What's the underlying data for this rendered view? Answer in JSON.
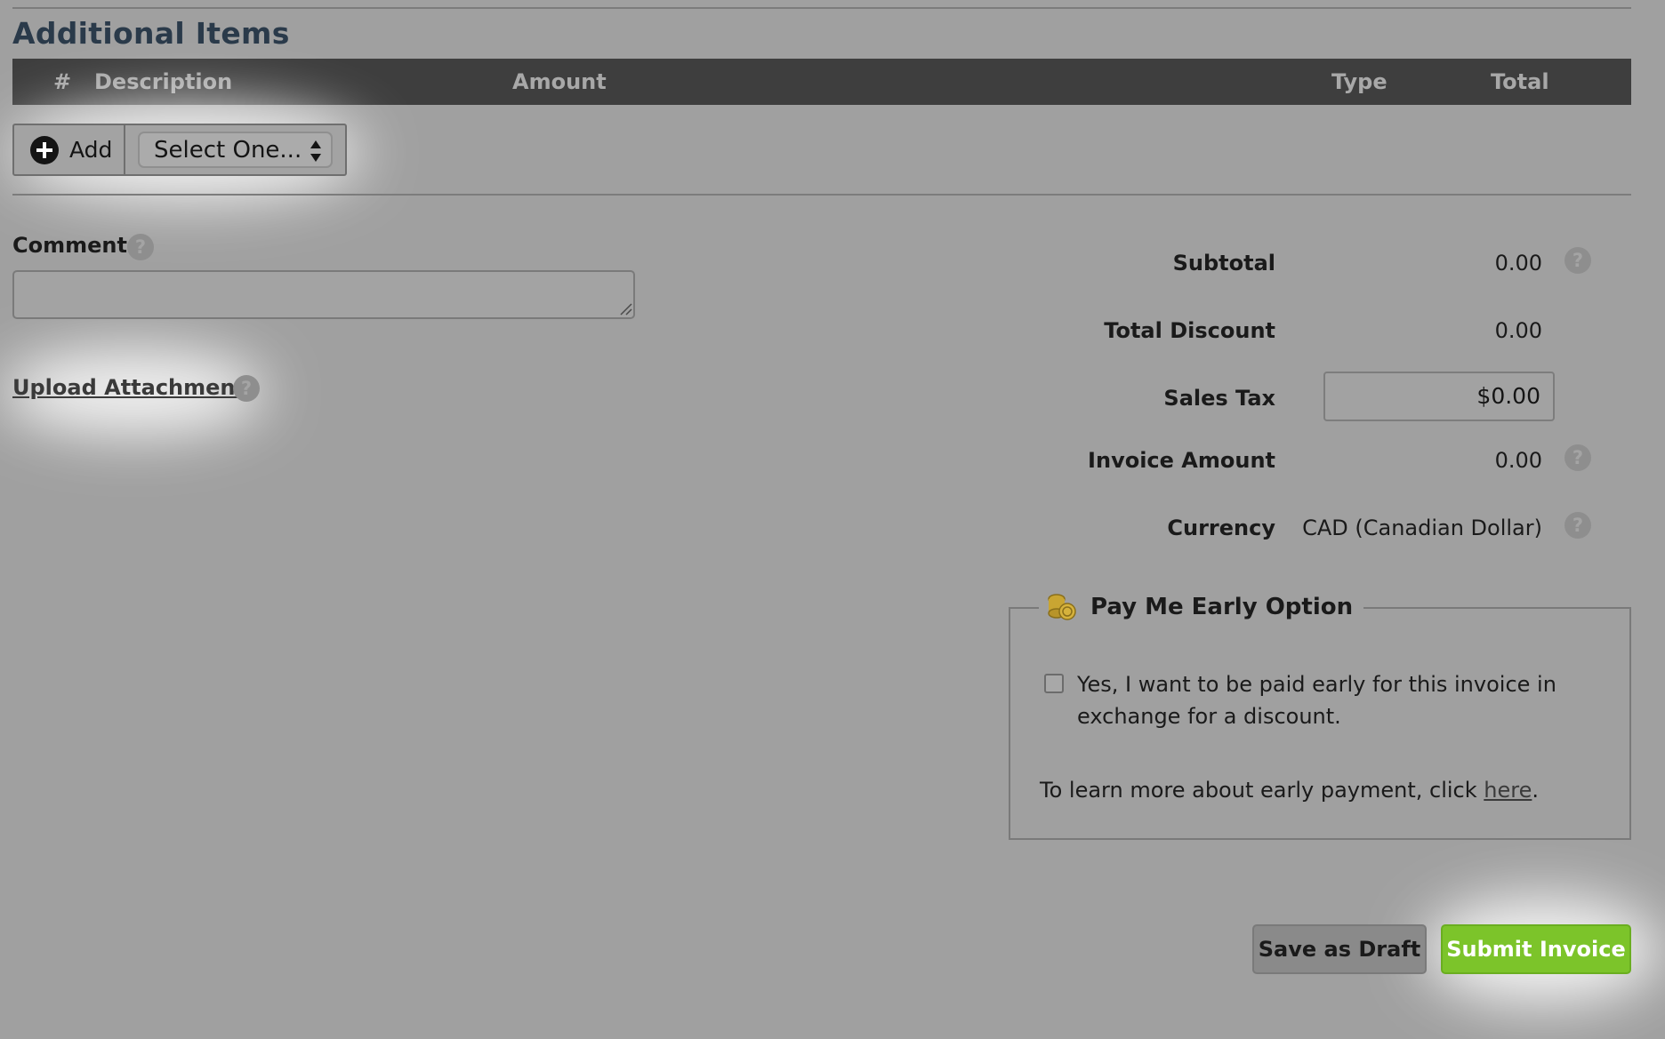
{
  "section": {
    "title": "Additional Items"
  },
  "table": {
    "columns": [
      "#",
      "Description",
      "Amount",
      "Type",
      "Total"
    ]
  },
  "add_row": {
    "add_label": "Add",
    "select_value": "Select One..."
  },
  "comment": {
    "label": "Comment",
    "value": ""
  },
  "upload": {
    "label": "Upload Attachment"
  },
  "totals": {
    "subtotal_label": "Subtotal",
    "subtotal_value": "0.00",
    "discount_label": "Total Discount",
    "discount_value": "0.00",
    "tax_label": "Sales Tax",
    "tax_value": "$0.00",
    "invoice_label": "Invoice Amount",
    "invoice_value": "0.00",
    "currency_label": "Currency",
    "currency_value": "CAD (Canadian Dollar)"
  },
  "pay_early": {
    "title": "Pay Me Early Option",
    "checkbox_text": "Yes, I want to be paid early for this invoice in exchange for a discount.",
    "learn_prefix": "To learn more about early payment, click ",
    "learn_link": "here",
    "learn_suffix": "."
  },
  "help_glyph": "?",
  "actions": {
    "draft_label": "Save as Draft",
    "submit_label": "Submit Invoice"
  },
  "colors": {
    "background": "#a0a0a0",
    "header_bar": "#3e3e3e",
    "title": "#2a3a4a",
    "submit": "#7cc42a"
  },
  "icons": [
    "plus-circle-icon",
    "select-arrows-icon",
    "help-icon",
    "resize-grip-icon",
    "coins-icon"
  ]
}
